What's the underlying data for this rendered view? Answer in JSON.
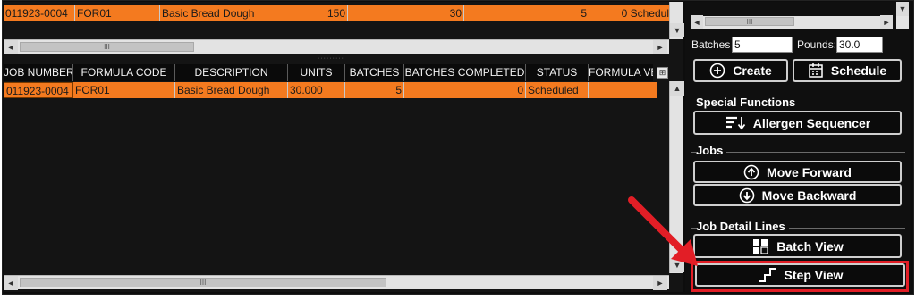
{
  "top_grid": {
    "row": [
      "011923-0004",
      "FOR01",
      "Basic Bread Dough",
      "150",
      "30",
      "5",
      "0 Schedul"
    ]
  },
  "splitter_grip": "·········",
  "detail_grid": {
    "columns": [
      "JOB NUMBER",
      "FORMULA CODE",
      "DESCRIPTION",
      "UNITS",
      "BATCHES",
      "BATCHES COMPLETED",
      "STATUS",
      "FORMULA VE"
    ],
    "row": [
      "011923-0004",
      "FOR01",
      "Basic Bread Dough",
      "30.000",
      "5",
      "0",
      "Scheduled",
      ""
    ]
  },
  "scroll": {
    "left_arrow": "◄",
    "right_arrow": "►",
    "up_arrow": "▲",
    "down_arrow": "▼",
    "grip": "III"
  },
  "batches": {
    "label": "Batches",
    "value": "5"
  },
  "pounds": {
    "label": "Pounds:",
    "value": "30.0"
  },
  "buttons": {
    "create": "Create",
    "schedule": "Schedule",
    "allergen": "Allergen Sequencer",
    "move_forward": "Move Forward",
    "move_backward": "Move Backward",
    "batch_view": "Batch View",
    "step_view": "Step View"
  },
  "groups": {
    "special": "Special Functions",
    "jobs": "Jobs",
    "detail_lines": "Job Detail Lines"
  },
  "colors": {
    "row_highlight": "#f47a1f",
    "callout": "#e21e26"
  },
  "icons": [
    "plus-circle-icon",
    "calendar-icon",
    "sort-down-icon",
    "up-circle-icon",
    "down-circle-icon",
    "grid-icon",
    "step-icon",
    "column-chooser-icon"
  ]
}
